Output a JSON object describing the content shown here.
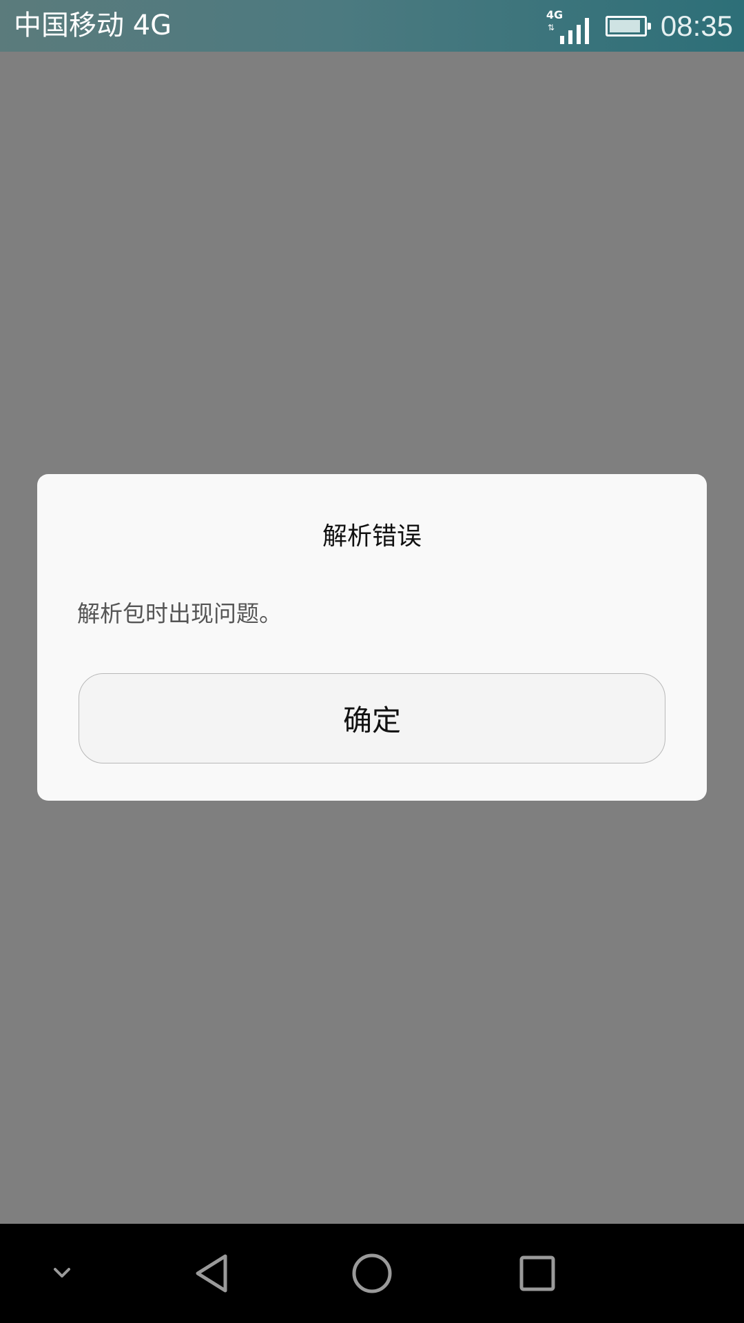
{
  "status_bar": {
    "carrier": "中国移动 4G",
    "network_type": "4G",
    "time": "08:35",
    "icons": {
      "signal": "signal-icon",
      "battery": "battery-icon"
    }
  },
  "dialog": {
    "title": "解析错误",
    "message": "解析包时出现问题。",
    "confirm_label": "确定"
  },
  "nav_bar": {
    "icons": [
      "chevron-down-icon",
      "back-icon",
      "home-icon",
      "recents-icon"
    ]
  },
  "colors": {
    "background_dim": "#7f7f7f",
    "dialog_bg": "#f9f9f9",
    "nav_bar_bg": "#000000",
    "status_bar_teal": "#2d6f78"
  }
}
